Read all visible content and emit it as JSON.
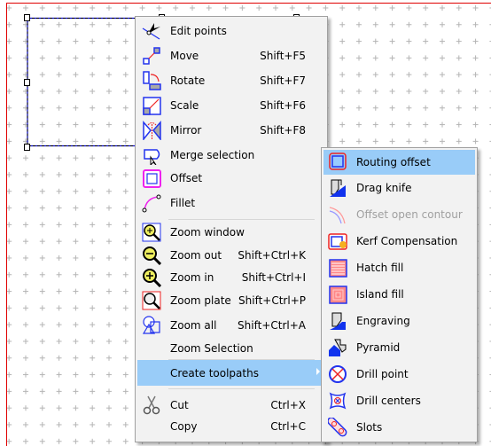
{
  "context_menu": {
    "items": [
      {
        "label": "Edit points",
        "shortcut": "",
        "icon": "edit-points-icon"
      },
      {
        "label": "Move",
        "shortcut": "Shift+F5",
        "icon": "move-icon"
      },
      {
        "label": "Rotate",
        "shortcut": "Shift+F7",
        "icon": "rotate-icon"
      },
      {
        "label": "Scale",
        "shortcut": "Shift+F6",
        "icon": "scale-icon"
      },
      {
        "label": "Mirror",
        "shortcut": "Shift+F8",
        "icon": "mirror-icon"
      },
      {
        "label": "Merge selection",
        "shortcut": "",
        "icon": "merge-selection-icon"
      },
      {
        "label": "Offset",
        "shortcut": "",
        "icon": "offset-icon"
      },
      {
        "label": "Fillet",
        "shortcut": "",
        "icon": "fillet-icon"
      },
      {
        "label": "Zoom window",
        "shortcut": "",
        "icon": "zoom-window-icon"
      },
      {
        "label": "Zoom out",
        "shortcut": "Shift+Ctrl+K",
        "icon": "zoom-out-icon"
      },
      {
        "label": "Zoom in",
        "shortcut": "Shift+Ctrl+I",
        "icon": "zoom-in-icon"
      },
      {
        "label": "Zoom plate",
        "shortcut": "Shift+Ctrl+P",
        "icon": "zoom-plate-icon"
      },
      {
        "label": "Zoom all",
        "shortcut": "Shift+Ctrl+A",
        "icon": "zoom-all-icon"
      },
      {
        "label": "Zoom Selection",
        "shortcut": "",
        "icon": ""
      },
      {
        "label": "Create toolpaths",
        "shortcut": "",
        "icon": "",
        "highlighted": true,
        "submenu": true
      },
      {
        "label": "Cut",
        "shortcut": "Ctrl+X",
        "icon": "scissors-icon"
      },
      {
        "label": "Copy",
        "shortcut": "Ctrl+C",
        "icon": ""
      }
    ]
  },
  "submenu": {
    "items": [
      {
        "label": "Routing offset",
        "icon": "routing-offset-icon",
        "highlighted": true
      },
      {
        "label": "Drag knife",
        "icon": "drag-knife-icon"
      },
      {
        "label": "Offset open contour",
        "icon": "offset-open-contour-icon",
        "disabled": true
      },
      {
        "label": "Kerf Compensation",
        "icon": "kerf-compensation-icon"
      },
      {
        "label": "Hatch fill",
        "icon": "hatch-fill-icon"
      },
      {
        "label": "Island fill",
        "icon": "island-fill-icon"
      },
      {
        "label": "Engraving",
        "icon": "engraving-icon"
      },
      {
        "label": "Pyramid",
        "icon": "pyramid-icon"
      },
      {
        "label": "Drill point",
        "icon": "drill-point-icon"
      },
      {
        "label": "Drill centers",
        "icon": "drill-centers-icon"
      },
      {
        "label": "Slots",
        "icon": "slots-icon"
      }
    ]
  },
  "colors": {
    "highlight": "#99ccf8",
    "plate_border": "#e00000",
    "selection": "#0000cc",
    "accent_blue": "#2233ee",
    "accent_red": "#ee2222",
    "accent_magenta": "#ee22ee"
  }
}
